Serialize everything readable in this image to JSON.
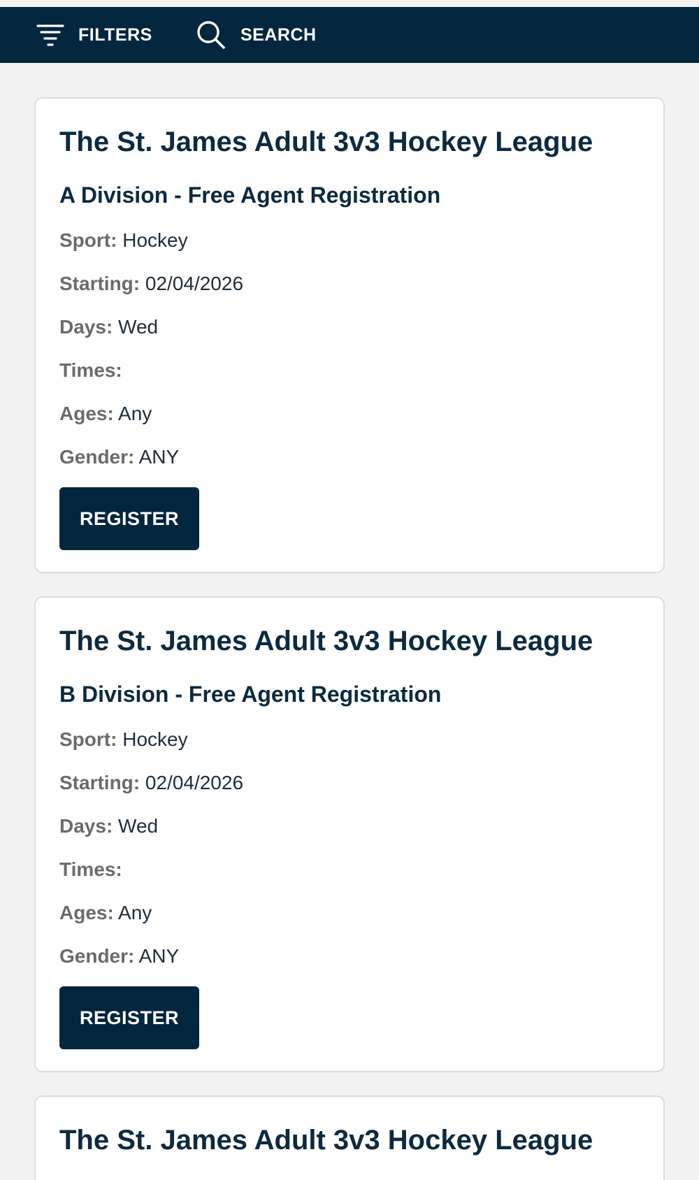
{
  "topbar": {
    "filters_label": "FILTERS",
    "search_label": "SEARCH",
    "background": "#03263f"
  },
  "labels": {
    "sport": "Sport:",
    "starting": "Starting:",
    "days": "Days:",
    "times": "Times:",
    "ages": "Ages:",
    "gender": "Gender:"
  },
  "cards": [
    {
      "title": "The St. James Adult 3v3 Hockey League",
      "subtitle": "A Division - Free Agent Registration",
      "sport": "Hockey",
      "starting": "02/04/2026",
      "days": "Wed",
      "times": "",
      "ages": "Any",
      "gender": "ANY",
      "button": "REGISTER"
    },
    {
      "title": "The St. James Adult 3v3 Hockey League",
      "subtitle": "B Division - Free Agent Registration",
      "sport": "Hockey",
      "starting": "02/04/2026",
      "days": "Wed",
      "times": "",
      "ages": "Any",
      "gender": "ANY",
      "button": "REGISTER"
    },
    {
      "title": "The St. James Adult 3v3 Hockey League"
    }
  ],
  "colors": {
    "brand_navy": "#03263f",
    "title_text": "#0c2a40",
    "label_gray": "#6b6b6b",
    "page_bg": "#f2f2f2"
  }
}
